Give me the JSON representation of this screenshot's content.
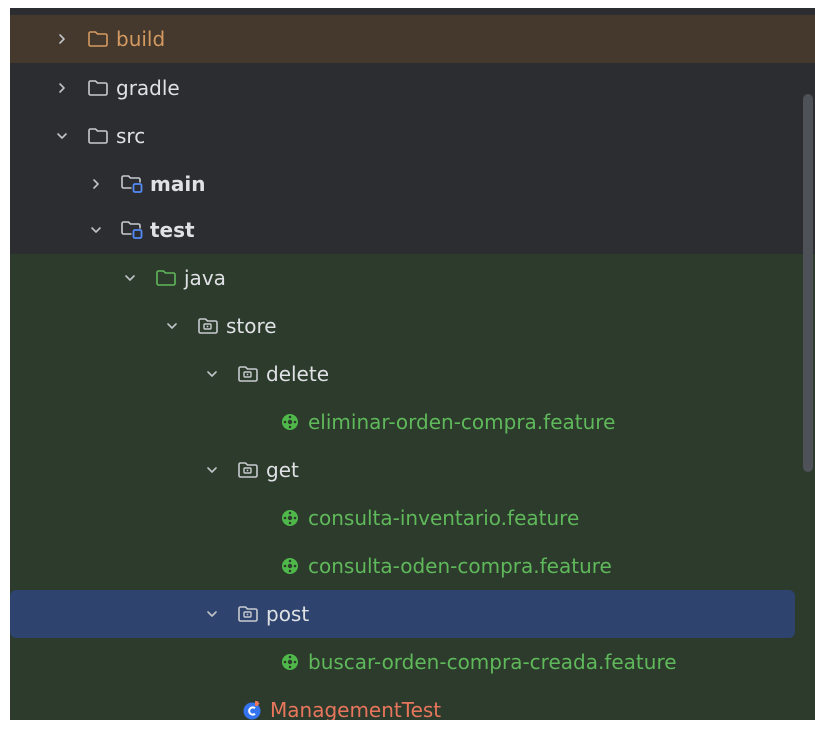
{
  "project_tree": {
    "items": [
      {
        "label": "build",
        "icon": "folder-icon",
        "chevron": "collapsed",
        "depth": 0,
        "style": "excluded"
      },
      {
        "label": "gradle",
        "icon": "folder-icon",
        "chevron": "collapsed",
        "depth": 0,
        "style": "normal"
      },
      {
        "label": "src",
        "icon": "folder-icon",
        "chevron": "expanded",
        "depth": 0,
        "style": "normal"
      },
      {
        "label": "main",
        "icon": "module-folder-icon",
        "chevron": "collapsed",
        "depth": 1,
        "style": "bold"
      },
      {
        "label": "test",
        "icon": "module-folder-icon",
        "chevron": "expanded",
        "depth": 1,
        "style": "bold"
      },
      {
        "label": "java",
        "icon": "test-root-folder-icon",
        "chevron": "expanded",
        "depth": 2,
        "style": "testsrc"
      },
      {
        "label": "store",
        "icon": "package-icon",
        "chevron": "expanded",
        "depth": 3,
        "style": "testsrc"
      },
      {
        "label": "delete",
        "icon": "package-icon",
        "chevron": "expanded",
        "depth": 4,
        "style": "testsrc"
      },
      {
        "label": "eliminar-orden-compra.feature",
        "icon": "cucumber-icon",
        "chevron": "none",
        "depth": 5,
        "style": "testsrc"
      },
      {
        "label": "get",
        "icon": "package-icon",
        "chevron": "expanded",
        "depth": 4,
        "style": "testsrc"
      },
      {
        "label": "consulta-inventario.feature",
        "icon": "cucumber-icon",
        "chevron": "none",
        "depth": 5,
        "style": "testsrc"
      },
      {
        "label": "consulta-oden-compra.feature",
        "icon": "cucumber-icon",
        "chevron": "none",
        "depth": 5,
        "style": "testsrc"
      },
      {
        "label": "post",
        "icon": "package-icon",
        "chevron": "expanded",
        "depth": 4,
        "style": "selected"
      },
      {
        "label": "buscar-orden-compra-creada.feature",
        "icon": "cucumber-icon",
        "chevron": "none",
        "depth": 5,
        "style": "testsrc"
      },
      {
        "label": "ManagementTest",
        "icon": "java-class-icon",
        "chevron": "none",
        "depth": 4,
        "style": "testsrc"
      }
    ]
  },
  "colors": {
    "background": "#2b2d30",
    "excluded_row": "#44392c",
    "test_source_row": "#2c3b2c",
    "selected_row": "#2e436e",
    "excluded_text": "#d59a61",
    "feature_text": "#5fb85a",
    "test_class_text": "#e8765d"
  }
}
